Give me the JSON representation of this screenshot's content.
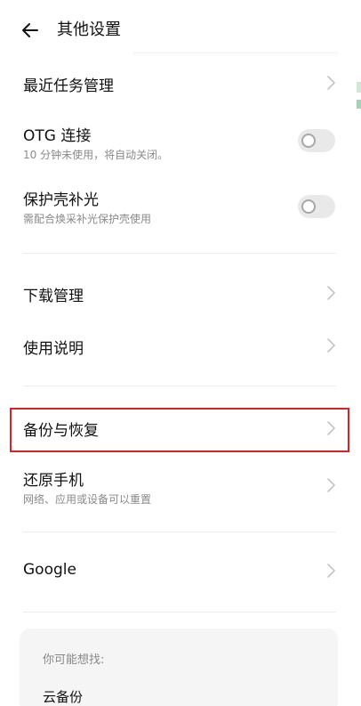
{
  "header": {
    "title": "其他设置",
    "back_icon": "back-arrow-icon"
  },
  "settings": {
    "recent_tasks": {
      "label": "最近任务管理"
    },
    "otg": {
      "label": "OTG 连接",
      "subtitle": "10 分钟未使用，将自动关闭。",
      "enabled": false
    },
    "case_fill_light": {
      "label": "保护壳补光",
      "subtitle": "需配合焕采补光保护壳使用",
      "enabled": false
    },
    "download_management": {
      "label": "下载管理"
    },
    "user_guide": {
      "label": "使用说明"
    },
    "backup_restore": {
      "label": "备份与恢复",
      "highlighted": true
    },
    "reset_phone": {
      "label": "还原手机",
      "subtitle": "网络、应用或设备可以重置"
    },
    "google": {
      "label": "Google"
    }
  },
  "suggestions": {
    "heading": "你可能想找:",
    "items": [
      "云备份"
    ]
  },
  "colors": {
    "highlight": "#e02020",
    "toggle_off": "#e9e9e9",
    "divider": "#ececec",
    "subtitle": "#8a8a8a"
  }
}
